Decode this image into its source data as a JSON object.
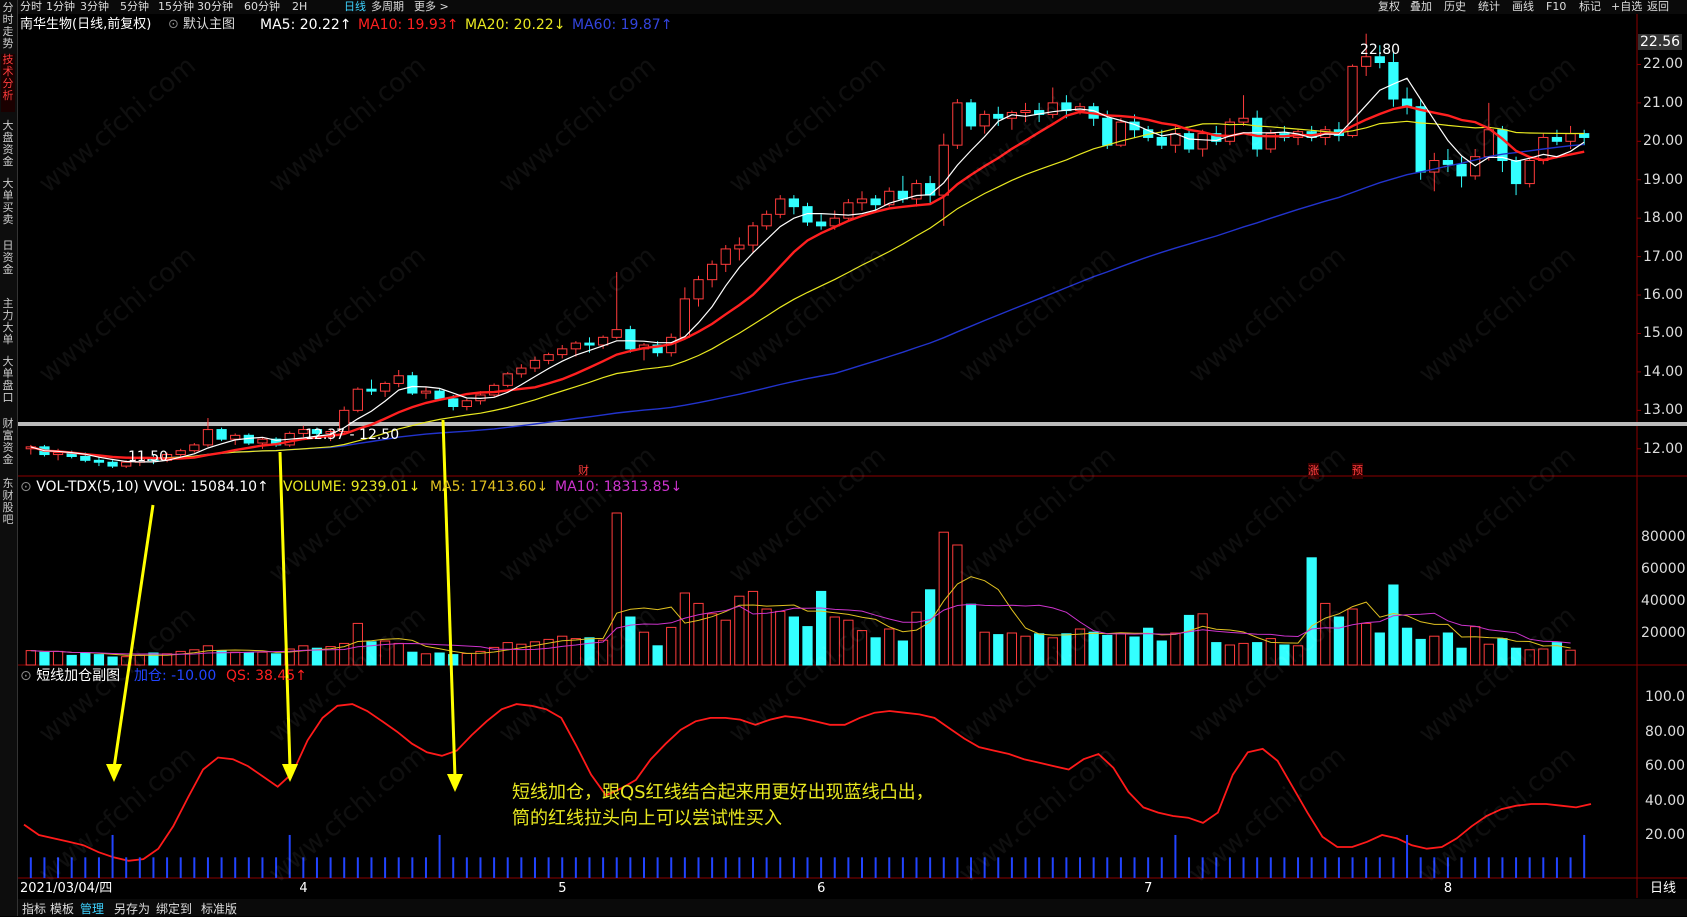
{
  "topbar": {
    "periods": [
      {
        "label": "分时",
        "active": false
      },
      {
        "label": "1分钟",
        "active": false
      },
      {
        "label": "3分钟",
        "active": false
      },
      {
        "label": "5分钟",
        "active": false
      },
      {
        "label": "15分钟",
        "active": false
      },
      {
        "label": "30分钟",
        "active": false
      },
      {
        "label": "60分钟",
        "active": false
      },
      {
        "label": "2H",
        "active": false
      },
      {
        "label": "日线",
        "active": true
      },
      {
        "label": "多周期",
        "active": false
      },
      {
        "label": "更多 >",
        "active": false
      }
    ],
    "tools": [
      "复权",
      "叠加",
      "历史",
      "统计",
      "画线",
      "F10",
      "标记",
      "+自选",
      "返回"
    ]
  },
  "sidebar": {
    "items": [
      {
        "label": "分时走势",
        "active": false
      },
      {
        "label": "技术分析",
        "active": true
      },
      {
        "label": "大盘资金",
        "active": false
      },
      {
        "label": "大单买卖",
        "active": false
      },
      {
        "label": "日资金",
        "active": false
      },
      {
        "label": "主力大单",
        "active": false
      },
      {
        "label": "大单盘口",
        "active": false
      },
      {
        "label": "财富资金",
        "active": false
      },
      {
        "label": "东财股吧",
        "active": false
      }
    ]
  },
  "main_panel": {
    "stock": "南华生物(日线,前复权)",
    "indicator_name": "默认主图",
    "ma5": "MA5: 20.22↑",
    "ma10": "MA10: 19.93↑",
    "ma20": "MA20: 20.22↓",
    "ma60": "MA60: 19.87↑",
    "high_label": "22.80",
    "low_label": "11.50",
    "range_label": "12.37 - 12.50",
    "last_price": "22.56",
    "y_ticks": [
      "22.00",
      "21.00",
      "20.00",
      "19.00",
      "18.00",
      "17.00",
      "16.00",
      "15.00",
      "14.00",
      "13.00",
      "12.00"
    ],
    "marker_cai": "财",
    "marker_zhang": "涨",
    "marker_yu": "预"
  },
  "volume_panel": {
    "name": "VOL-TDX(5,10) VVOL: 15084.10↑",
    "volume": "VOLUME: 9239.01↓",
    "ma5": "MA5: 17413.60↓",
    "ma10": "MA10: 18313.85↓",
    "y_ticks": [
      "80000",
      "60000",
      "40000",
      "20000"
    ]
  },
  "sub_panel": {
    "name": "短线加仓副图",
    "jiacang": "加仓: -10.00",
    "qs": "QS: 38.45↑",
    "y_ticks": [
      "100.0",
      "80.00",
      "60.00",
      "40.00",
      "20.00"
    ],
    "annotation_line1": "短线加仓，跟QS红线结合起来用更好出现蓝线凸出，",
    "annotation_line2": "筒的红线拉头向上可以尝试性买入"
  },
  "x_axis": {
    "start_date": "2021/03/04/四",
    "months": [
      "4",
      "5",
      "6",
      "7",
      "8"
    ],
    "period_label": "日线"
  },
  "bottombar": {
    "items": [
      "指标",
      "模板",
      "管理",
      "另存为",
      "绑定到",
      "标准版"
    ]
  },
  "watermark": "www.cfchi.com",
  "colors": {
    "up": "#ff3c3c",
    "down": "#33ffff",
    "ma5": "#ffffff",
    "ma10": "#ff2020",
    "ma20": "#e8e820",
    "ma60": "#2233cc",
    "vol_ma5": "#e0c020",
    "vol_ma10": "#cc33cc",
    "qs": "#ff1a1a",
    "jiacang": "#2244ff",
    "arrow": "#ffff00",
    "annotation": "#e8e820"
  },
  "chart_data": {
    "type": "candlestick",
    "price": {
      "ylim": [
        11.5,
        23.0
      ],
      "high": 22.8,
      "low": 11.5,
      "ohlc": [
        [
          12.0,
          12.1,
          11.85,
          12.05
        ],
        [
          12.05,
          12.1,
          11.8,
          11.85
        ],
        [
          11.85,
          12.0,
          11.7,
          11.9
        ],
        [
          11.9,
          11.95,
          11.75,
          11.8
        ],
        [
          11.8,
          11.9,
          11.65,
          11.7
        ],
        [
          11.7,
          11.8,
          11.55,
          11.65
        ],
        [
          11.65,
          11.7,
          11.5,
          11.55
        ],
        [
          11.55,
          11.7,
          11.5,
          11.65
        ],
        [
          11.65,
          11.8,
          11.55,
          11.75
        ],
        [
          11.75,
          11.85,
          11.6,
          11.7
        ],
        [
          11.7,
          11.9,
          11.65,
          11.85
        ],
        [
          11.85,
          12.0,
          11.8,
          11.95
        ],
        [
          11.95,
          12.15,
          11.9,
          12.1
        ],
        [
          12.1,
          12.8,
          12.05,
          12.5
        ],
        [
          12.5,
          12.55,
          12.2,
          12.25
        ],
        [
          12.25,
          12.4,
          12.1,
          12.35
        ],
        [
          12.35,
          12.4,
          12.1,
          12.15
        ],
        [
          12.15,
          12.3,
          12.0,
          12.25
        ],
        [
          12.25,
          12.3,
          12.05,
          12.1
        ],
        [
          12.1,
          12.45,
          12.05,
          12.4
        ],
        [
          12.4,
          12.6,
          12.3,
          12.5
        ],
        [
          12.5,
          12.55,
          12.3,
          12.4
        ],
        [
          12.4,
          12.5,
          12.2,
          12.45
        ],
        [
          12.45,
          13.1,
          12.4,
          13.0
        ],
        [
          13.0,
          13.6,
          12.95,
          13.55
        ],
        [
          13.55,
          13.8,
          13.4,
          13.5
        ],
        [
          13.5,
          13.75,
          13.35,
          13.7
        ],
        [
          13.7,
          14.05,
          13.6,
          13.9
        ],
        [
          13.9,
          14.0,
          13.4,
          13.45
        ],
        [
          13.45,
          13.6,
          13.3,
          13.5
        ],
        [
          13.5,
          13.55,
          13.25,
          13.3
        ],
        [
          13.3,
          13.4,
          13.0,
          13.1
        ],
        [
          13.1,
          13.3,
          13.0,
          13.25
        ],
        [
          13.25,
          13.5,
          13.15,
          13.4
        ],
        [
          13.4,
          13.7,
          13.35,
          13.65
        ],
        [
          13.65,
          14.0,
          13.6,
          13.95
        ],
        [
          13.95,
          14.2,
          13.85,
          14.1
        ],
        [
          14.1,
          14.4,
          14.0,
          14.3
        ],
        [
          14.3,
          14.5,
          14.2,
          14.45
        ],
        [
          14.45,
          14.7,
          14.35,
          14.6
        ],
        [
          14.6,
          14.8,
          14.4,
          14.75
        ],
        [
          14.75,
          14.9,
          14.5,
          14.7
        ],
        [
          14.7,
          14.95,
          14.6,
          14.9
        ],
        [
          14.9,
          16.6,
          14.85,
          15.1
        ],
        [
          15.1,
          15.2,
          14.5,
          14.6
        ],
        [
          14.6,
          14.75,
          14.3,
          14.7
        ],
        [
          14.7,
          14.8,
          14.4,
          14.5
        ],
        [
          14.5,
          15.0,
          14.4,
          14.9
        ],
        [
          14.9,
          16.2,
          14.85,
          15.9
        ],
        [
          15.9,
          16.5,
          15.7,
          16.4
        ],
        [
          16.4,
          16.9,
          16.2,
          16.8
        ],
        [
          16.8,
          17.3,
          16.6,
          17.2
        ],
        [
          17.2,
          17.5,
          16.9,
          17.3
        ],
        [
          17.3,
          17.9,
          17.1,
          17.8
        ],
        [
          17.8,
          18.2,
          17.7,
          18.1
        ],
        [
          18.1,
          18.6,
          18.0,
          18.5
        ],
        [
          18.5,
          18.6,
          18.1,
          18.3
        ],
        [
          18.3,
          18.4,
          17.8,
          17.9
        ],
        [
          17.9,
          18.1,
          17.7,
          17.8
        ],
        [
          17.8,
          18.2,
          17.7,
          18.0
        ],
        [
          18.0,
          18.5,
          17.95,
          18.4
        ],
        [
          18.4,
          18.7,
          18.2,
          18.5
        ],
        [
          18.5,
          18.6,
          18.2,
          18.35
        ],
        [
          18.35,
          18.8,
          18.3,
          18.7
        ],
        [
          18.7,
          19.1,
          18.4,
          18.5
        ],
        [
          18.5,
          19.0,
          18.3,
          18.9
        ],
        [
          18.9,
          19.1,
          18.4,
          18.6
        ],
        [
          18.6,
          20.2,
          17.8,
          19.9
        ],
        [
          19.9,
          21.1,
          19.8,
          21.0
        ],
        [
          21.0,
          21.1,
          20.3,
          20.4
        ],
        [
          20.4,
          20.8,
          20.2,
          20.7
        ],
        [
          20.7,
          20.9,
          20.4,
          20.6
        ],
        [
          20.6,
          20.8,
          20.3,
          20.75
        ],
        [
          20.75,
          21.0,
          20.5,
          20.8
        ],
        [
          20.8,
          21.0,
          20.5,
          20.7
        ],
        [
          20.7,
          21.4,
          20.6,
          21.0
        ],
        [
          21.0,
          21.2,
          20.6,
          20.8
        ],
        [
          20.8,
          21.0,
          20.7,
          20.9
        ],
        [
          20.9,
          21.0,
          20.4,
          20.6
        ],
        [
          20.6,
          20.8,
          19.8,
          19.9
        ],
        [
          19.9,
          20.6,
          19.85,
          20.5
        ],
        [
          20.5,
          20.7,
          20.1,
          20.3
        ],
        [
          20.3,
          20.4,
          20.0,
          20.1
        ],
        [
          20.1,
          20.3,
          19.8,
          19.9
        ],
        [
          19.9,
          20.4,
          19.7,
          20.2
        ],
        [
          20.2,
          20.3,
          19.7,
          19.8
        ],
        [
          19.8,
          20.3,
          19.6,
          20.2
        ],
        [
          20.2,
          20.4,
          19.9,
          20.0
        ],
        [
          20.0,
          20.6,
          19.9,
          20.5
        ],
        [
          20.5,
          21.2,
          20.4,
          20.6
        ],
        [
          20.6,
          20.8,
          19.6,
          19.8
        ],
        [
          19.8,
          20.3,
          19.7,
          20.2
        ],
        [
          20.2,
          20.4,
          20.0,
          20.1
        ],
        [
          20.1,
          20.3,
          19.9,
          20.25
        ],
        [
          20.25,
          20.4,
          20.0,
          20.1
        ],
        [
          20.1,
          20.4,
          19.9,
          20.3
        ],
        [
          20.3,
          20.5,
          20.0,
          20.15
        ],
        [
          20.15,
          22.0,
          20.1,
          21.95
        ],
        [
          21.95,
          22.8,
          21.7,
          22.2
        ],
        [
          22.2,
          22.5,
          21.9,
          22.05
        ],
        [
          22.05,
          22.3,
          20.9,
          21.1
        ],
        [
          21.1,
          21.4,
          20.7,
          20.9
        ],
        [
          20.9,
          21.1,
          19.0,
          19.2
        ],
        [
          19.2,
          19.7,
          18.7,
          19.5
        ],
        [
          19.5,
          19.8,
          19.2,
          19.4
        ],
        [
          19.4,
          19.6,
          18.8,
          19.1
        ],
        [
          19.1,
          19.8,
          19.0,
          19.6
        ],
        [
          19.6,
          21.0,
          19.5,
          20.3
        ],
        [
          20.3,
          20.4,
          19.2,
          19.5
        ],
        [
          19.5,
          19.6,
          18.6,
          18.9
        ],
        [
          18.9,
          19.6,
          18.8,
          19.5
        ],
        [
          19.5,
          20.2,
          19.4,
          20.1
        ],
        [
          20.1,
          20.3,
          19.9,
          20.0
        ],
        [
          20.0,
          20.4,
          19.8,
          20.2
        ],
        [
          20.2,
          20.3,
          19.9,
          20.1
        ]
      ]
    },
    "volume": [
      9000,
      8000,
      8500,
      6000,
      7500,
      6500,
      5000,
      5200,
      6000,
      7500,
      7000,
      8500,
      9500,
      12000,
      9000,
      8000,
      7500,
      8000,
      7000,
      10000,
      12000,
      10500,
      11500,
      13500,
      26000,
      14500,
      15000,
      13500,
      8000,
      7000,
      7500,
      6500,
      7200,
      8500,
      11000,
      14000,
      13000,
      14500,
      16000,
      18000,
      16500,
      17000,
      15500,
      95000,
      30000,
      20500,
      12000,
      23500,
      45000,
      38500,
      32000,
      28000,
      43000,
      46000,
      35000,
      33500,
      30000,
      24000,
      46000,
      30000,
      28000,
      21500,
      17000,
      22500,
      15000,
      33000,
      47000,
      83000,
      75000,
      38000,
      20500,
      19000,
      20000,
      18000,
      19500,
      17000,
      19500,
      22500,
      20500,
      18500,
      20000,
      17500,
      23000,
      15000,
      20000,
      31000,
      32000,
      14000,
      12500,
      13500,
      14000,
      16500,
      12500,
      12000,
      67000,
      38500,
      30000,
      35000,
      26000,
      20000,
      50000,
      23000,
      16000,
      18000,
      20000,
      10500,
      24000,
      13000,
      16500,
      10500,
      9500,
      10000,
      14000,
      9239
    ],
    "qs": [
      26,
      20,
      18,
      16,
      14,
      10,
      7,
      5,
      6,
      12,
      25,
      42,
      58,
      65,
      64,
      60,
      54,
      48,
      56,
      75,
      88,
      95,
      96,
      92,
      86,
      80,
      73,
      68,
      66,
      69,
      78,
      86,
      93,
      96,
      95,
      93,
      88,
      72,
      55,
      43,
      47,
      52,
      64,
      73,
      81,
      86,
      88,
      88,
      87,
      84,
      87,
      89,
      88,
      86,
      84,
      84,
      88,
      91,
      92,
      91,
      90,
      88,
      82,
      76,
      71,
      69,
      67,
      64,
      62,
      60,
      58,
      64,
      67,
      59,
      45,
      36,
      33,
      31,
      30,
      27,
      33,
      55,
      68,
      70,
      63,
      48,
      33,
      19,
      13,
      13,
      16,
      20,
      18,
      14,
      12,
      13,
      18,
      25,
      31,
      35,
      37,
      38,
      38,
      37,
      36,
      38
    ]
  }
}
